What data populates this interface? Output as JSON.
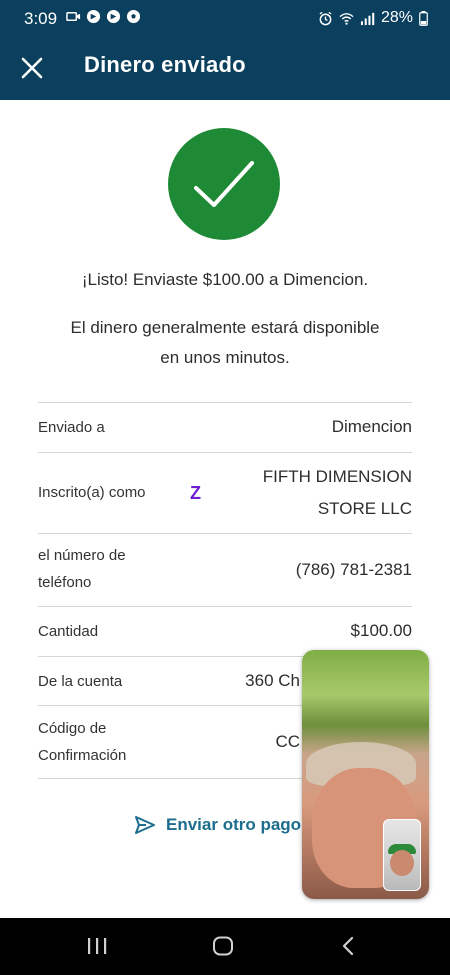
{
  "status_bar": {
    "time": "3:09",
    "battery": "28%",
    "left_icons": [
      "video-call-icon",
      "app-icon",
      "app-icon",
      "soccer-icon"
    ],
    "right_icons": [
      "alarm-icon",
      "wifi-icon",
      "signal-icon",
      "battery-icon"
    ]
  },
  "header": {
    "title": "Dinero enviado",
    "close_icon": "close-icon"
  },
  "success": {
    "icon": "check-icon",
    "color": "#1f8a35",
    "message": "¡Listo! Enviaste $100.00 a Dimencion.",
    "note_line1": "El dinero generalmente estará disponible",
    "note_line2": "en unos minutos."
  },
  "details": [
    {
      "label": "Enviado a",
      "value": "Dimencion"
    },
    {
      "label": "Inscrito(a) como",
      "value_line1": "FIFTH DIMENSION",
      "value_line2": "STORE LLC",
      "icon": "zelle-icon",
      "icon_glyph": "Z"
    },
    {
      "label_line1": "el número de",
      "label_line2": "teléfono",
      "value": "(786) 781-2381"
    },
    {
      "label": "Cantidad",
      "value": "$100.00"
    },
    {
      "label": "De la cuenta",
      "value": "360 Ch"
    },
    {
      "label_line1": "Código de",
      "label_line2": "Confirmación",
      "value": "CC"
    }
  ],
  "actions": {
    "send_again": "Enviar otro pago"
  },
  "colors": {
    "header_bg": "#0b3f5e",
    "accent_link": "#1d6d8f",
    "zelle": "#6d1ed4"
  }
}
